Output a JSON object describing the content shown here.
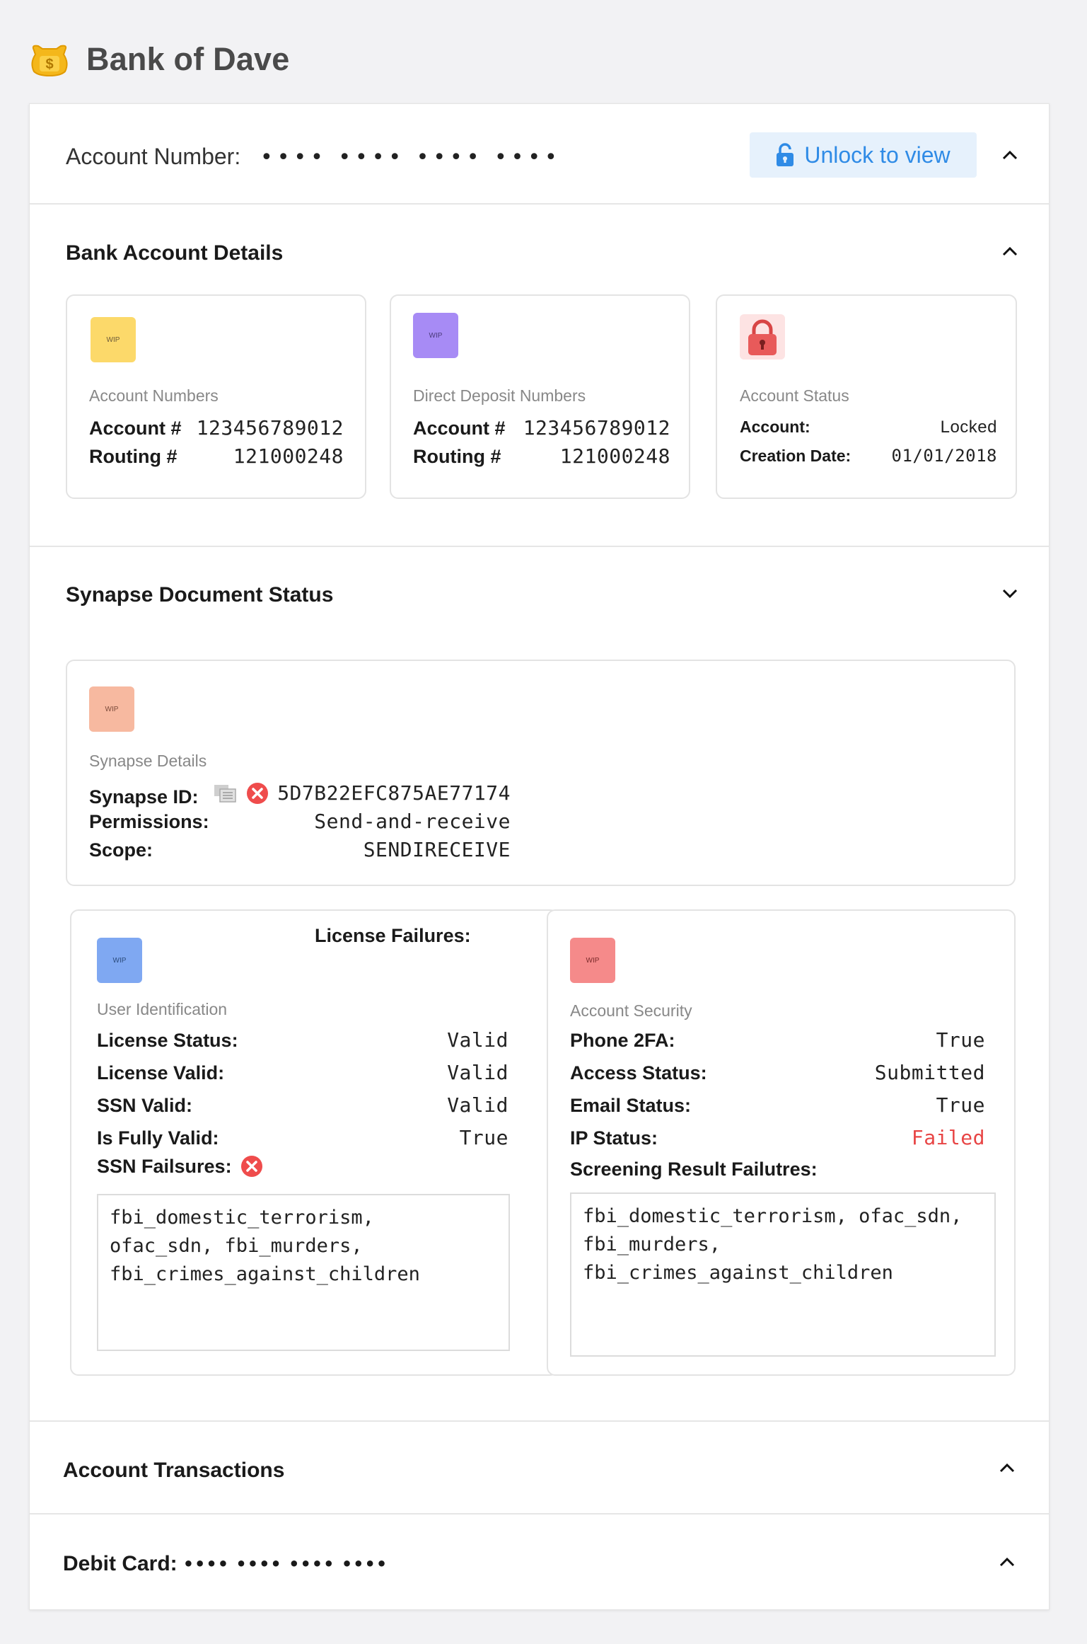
{
  "app": {
    "name": "Bank of Dave"
  },
  "account_header": {
    "label": "Account Number:",
    "masked": "•••• •••• •••• ••••",
    "unlock_label": "Unlock to view"
  },
  "bank_details": {
    "title": "Bank Account Details",
    "cards": [
      {
        "wip": "WIP",
        "caption": "Account Numbers",
        "rows": [
          {
            "k": "Account #",
            "v": "123456789012"
          },
          {
            "k": "Routing #",
            "v": "121000248"
          }
        ]
      },
      {
        "wip": "WIP",
        "caption": "Direct Deposit Numbers",
        "rows": [
          {
            "k": "Account #",
            "v": "123456789012"
          },
          {
            "k": "Routing #",
            "v": "121000248"
          }
        ]
      },
      {
        "caption": "Account Status",
        "rows": [
          {
            "k": "Account:",
            "v": "Locked"
          },
          {
            "k": "Creation Date:",
            "v": "01/01/2018"
          }
        ]
      }
    ]
  },
  "synapse": {
    "title": "Synapse Document Status",
    "details": {
      "wip": "WIP",
      "caption": "Synapse Details",
      "rows": [
        {
          "k": "Synapse ID:",
          "v": "5D7B22EFC875AE77174"
        },
        {
          "k": "Permissions:",
          "v": "Send-and-receive"
        },
        {
          "k": "Scope:",
          "v": "SENDIRECEIVE"
        }
      ]
    },
    "user_id": {
      "heading": "License Failures:",
      "wip": "WIP",
      "caption": "User Identification",
      "rows": [
        {
          "k": "License Status:",
          "v": "Valid"
        },
        {
          "k": "License Valid:",
          "v": "Valid"
        },
        {
          "k": "SSN Valid:",
          "v": "Valid"
        },
        {
          "k": "Is Fully Valid:",
          "v": "True"
        }
      ],
      "ssn_failures_label": "SSN Failsures:",
      "ssn_failures": "fbi_domestic_terrorism,\nofac_sdn, fbi_murders,\nfbi_crimes_against_children"
    },
    "security": {
      "wip": "WIP",
      "caption": "Account Security",
      "rows": [
        {
          "k": "Phone 2FA:",
          "v": "True"
        },
        {
          "k": "Access Status:",
          "v": "Submitted"
        },
        {
          "k": "Email Status:",
          "v": "True"
        },
        {
          "k": "IP Status:",
          "v": "Failed"
        }
      ],
      "screening_label": "Screening Result Failutres:",
      "screening": "fbi_domestic_terrorism, ofac_sdn,\nfbi_murders,\nfbi_crimes_against_children"
    }
  },
  "transactions": {
    "title": "Account Transactions"
  },
  "debit_card": {
    "title": "Debit Card:",
    "masked": "•••• •••• •••• ••••"
  },
  "colors": {
    "accent": "#2f8be6",
    "unlock_bg": "#e6f1fc",
    "wip_yellow": "#fcd96a",
    "wip_purple": "#a78bf5",
    "wip_salmon": "#f7b9a0",
    "wip_blue": "#7fa8f2",
    "wip_red": "#f58a8a",
    "fail": "#e84545"
  }
}
